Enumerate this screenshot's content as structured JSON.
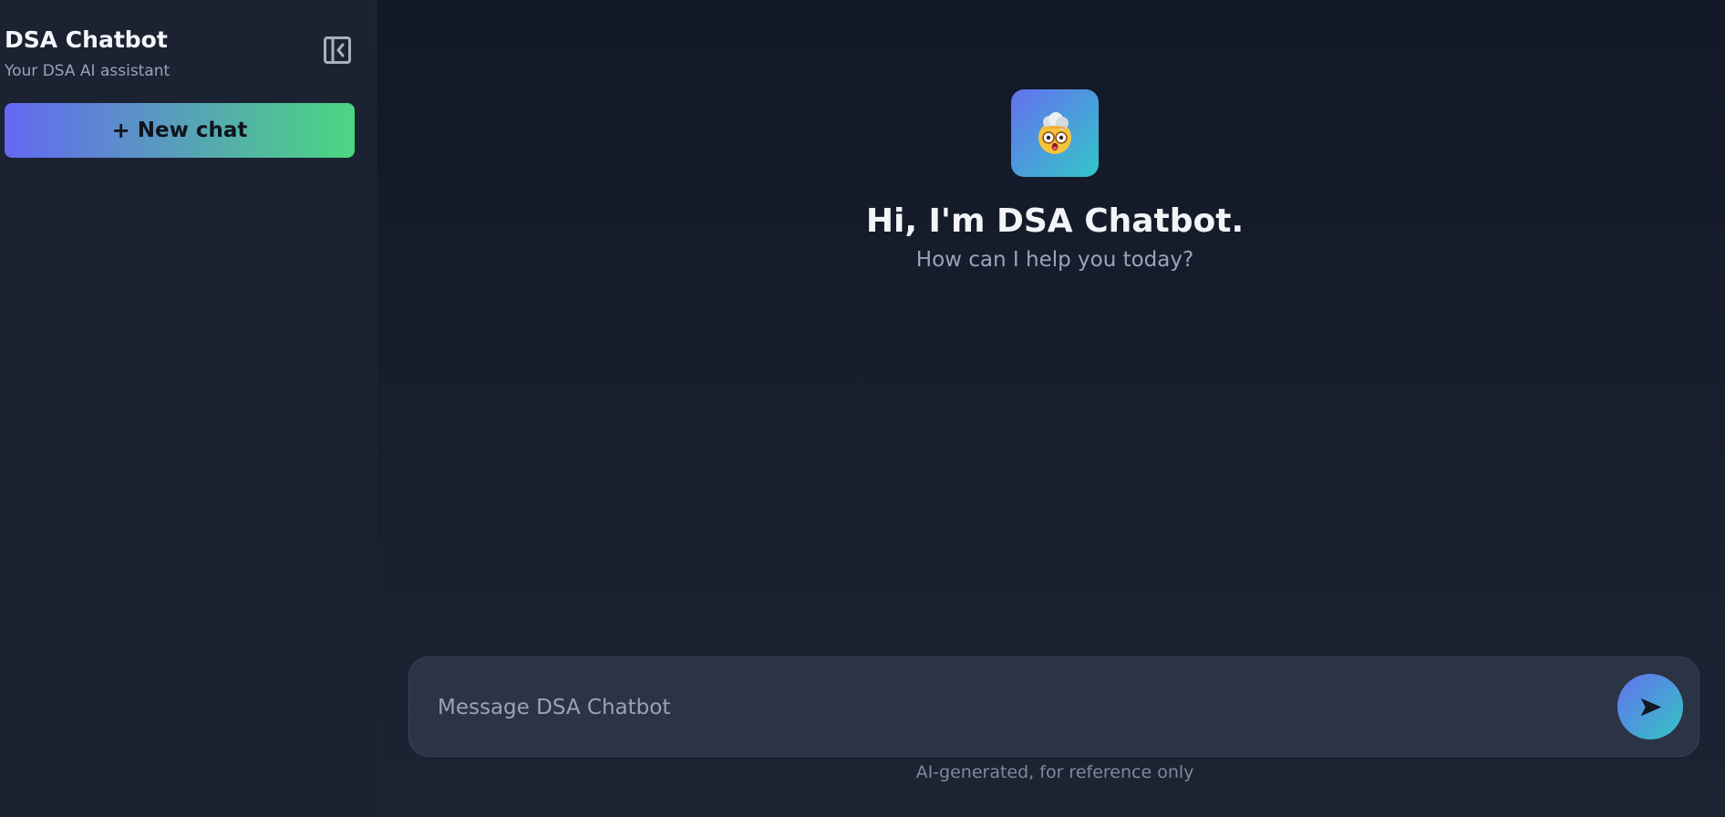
{
  "sidebar": {
    "title": "DSA Chatbot",
    "subtitle": "Your DSA AI assistant",
    "new_chat": {
      "icon": "+",
      "label": "New chat"
    },
    "collapse_icon": "sidebar-collapse-icon"
  },
  "main": {
    "welcome": {
      "title": "Hi, I'm DSA Chatbot.",
      "subtitle": "How can I help you today?"
    },
    "composer": {
      "placeholder": "Message DSA Chatbot",
      "value": "",
      "send_icon": "send-icon"
    },
    "disclaimer": "AI-generated, for reference only"
  },
  "icons": {
    "avatar": "mind-blown-face-icon"
  },
  "colors": {
    "background": "#121827",
    "sidebar": "#1b2232",
    "composer": "#2b3445",
    "new_chat_gradient_start": "#6468f2",
    "new_chat_gradient_end": "#4bd780",
    "accent_gradient_start": "#6470f0",
    "accent_gradient_end": "#32c7c8"
  }
}
